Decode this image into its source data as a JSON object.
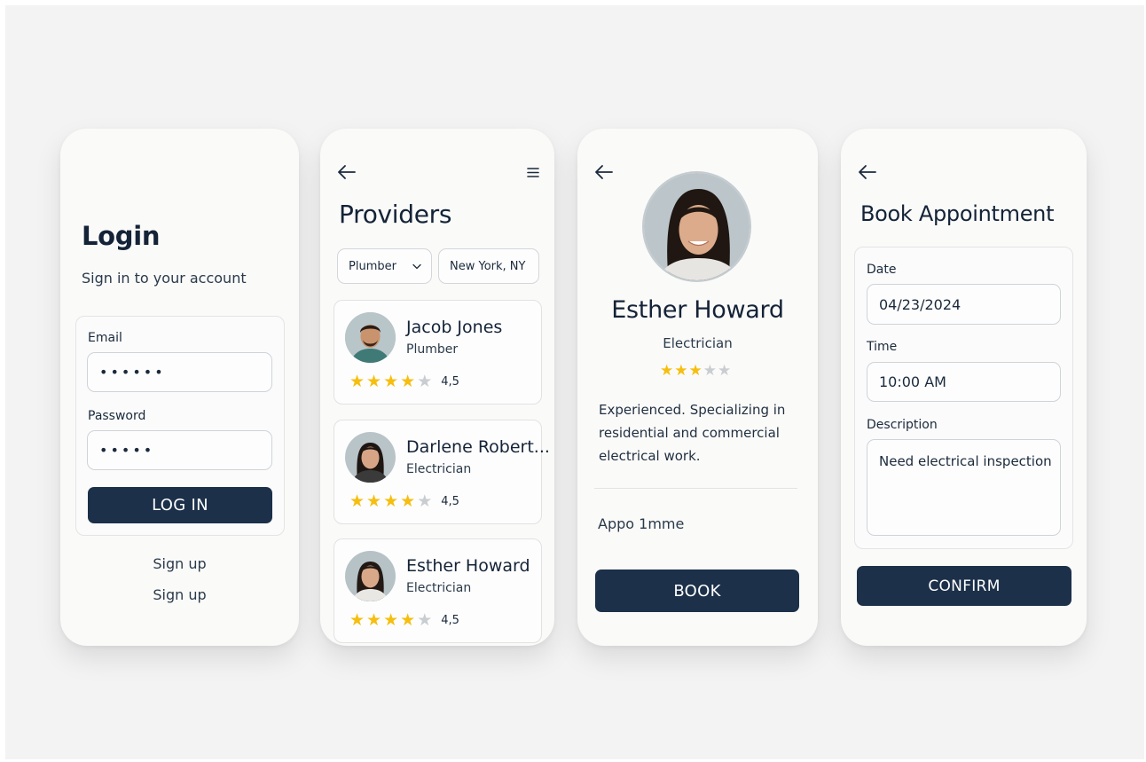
{
  "colors": {
    "accent": "#1c3049",
    "star": "#f6be10",
    "star_off": "#c9cdd1",
    "background": "#f3f3f3"
  },
  "login": {
    "title": "Login",
    "subtitle": "Sign in to your account",
    "email_label": "Email",
    "email_value": "••••••",
    "password_label": "Password",
    "password_value": "•••••",
    "login_button": "LOG IN",
    "signup_links": [
      "Sign up",
      "Sign up"
    ]
  },
  "providers": {
    "back_icon": "arrow-left-icon",
    "menu_icon": "hamburger-menu-icon",
    "title": "Providers",
    "filter_category": "Plumber",
    "filter_location": "New York, NY",
    "items": [
      {
        "name": "Jacob Jones",
        "role": "Plumber",
        "rating": "4,5",
        "stars_filled": 4
      },
      {
        "name": "Darlene Robert...",
        "role": "Electrician",
        "rating": "4,5",
        "stars_filled": 4
      },
      {
        "name": "Esther Howard",
        "role": "Electrician",
        "rating": "4,5",
        "stars_filled": 4
      }
    ]
  },
  "profile": {
    "back_icon": "arrow-left-icon",
    "name": "Esther Howard",
    "role": "Electrician",
    "stars_filled": 3,
    "description": "Experienced. Specializing in residential and commercial electrical work.",
    "appointment_label": "Appo 1mme",
    "book_button": "BOOK"
  },
  "booking": {
    "back_icon": "arrow-left-icon",
    "title": "Book Appointment",
    "date_label": "Date",
    "date_value": "04/23/2024",
    "time_label": "Time",
    "time_value": "10:00 AM",
    "description_label": "Description",
    "description_value": "Need electrical inspection",
    "confirm_button": "CONFIRM"
  }
}
